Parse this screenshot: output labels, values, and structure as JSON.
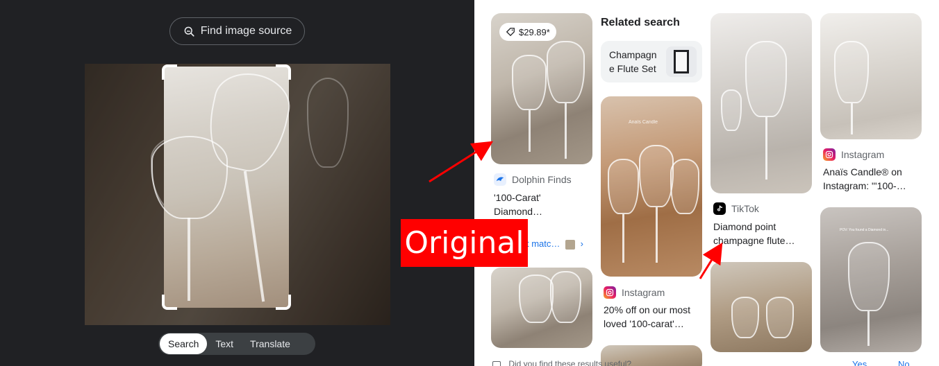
{
  "left_pane": {
    "find_source_label": "Find image source",
    "tabs": [
      "Search",
      "Text",
      "Translate"
    ],
    "active_tab": "Search"
  },
  "annotation": {
    "label": "Original",
    "color": "#ff0000"
  },
  "results": {
    "col1": {
      "price": "$29.89*",
      "source": "Dolphin Finds",
      "title_line1": "'100-Carat'",
      "title_line2": "Diamond…",
      "exact_matches": "t matc…"
    },
    "related": {
      "heading": "Related search",
      "chip_line1": "Champagn",
      "chip_line2": "e Flute Set"
    },
    "col2": {
      "source": "Instagram",
      "title_line1": "20% off on our most",
      "title_line2": "loved '100-carat'…",
      "img_text": "Anaïs Candle"
    },
    "col3": {
      "source": "TikTok",
      "title_line1": "Diamond point",
      "title_line2": "champagne flute…"
    },
    "col4": {
      "source": "Instagram",
      "title_line1": "Anaïs Candle® on",
      "title_line2": "Instagram: \"'100-…",
      "img_text": "POV: You found a Diamond in..."
    }
  },
  "footer": {
    "question": "Did you find these results useful?",
    "yes": "Yes",
    "no": "No"
  }
}
